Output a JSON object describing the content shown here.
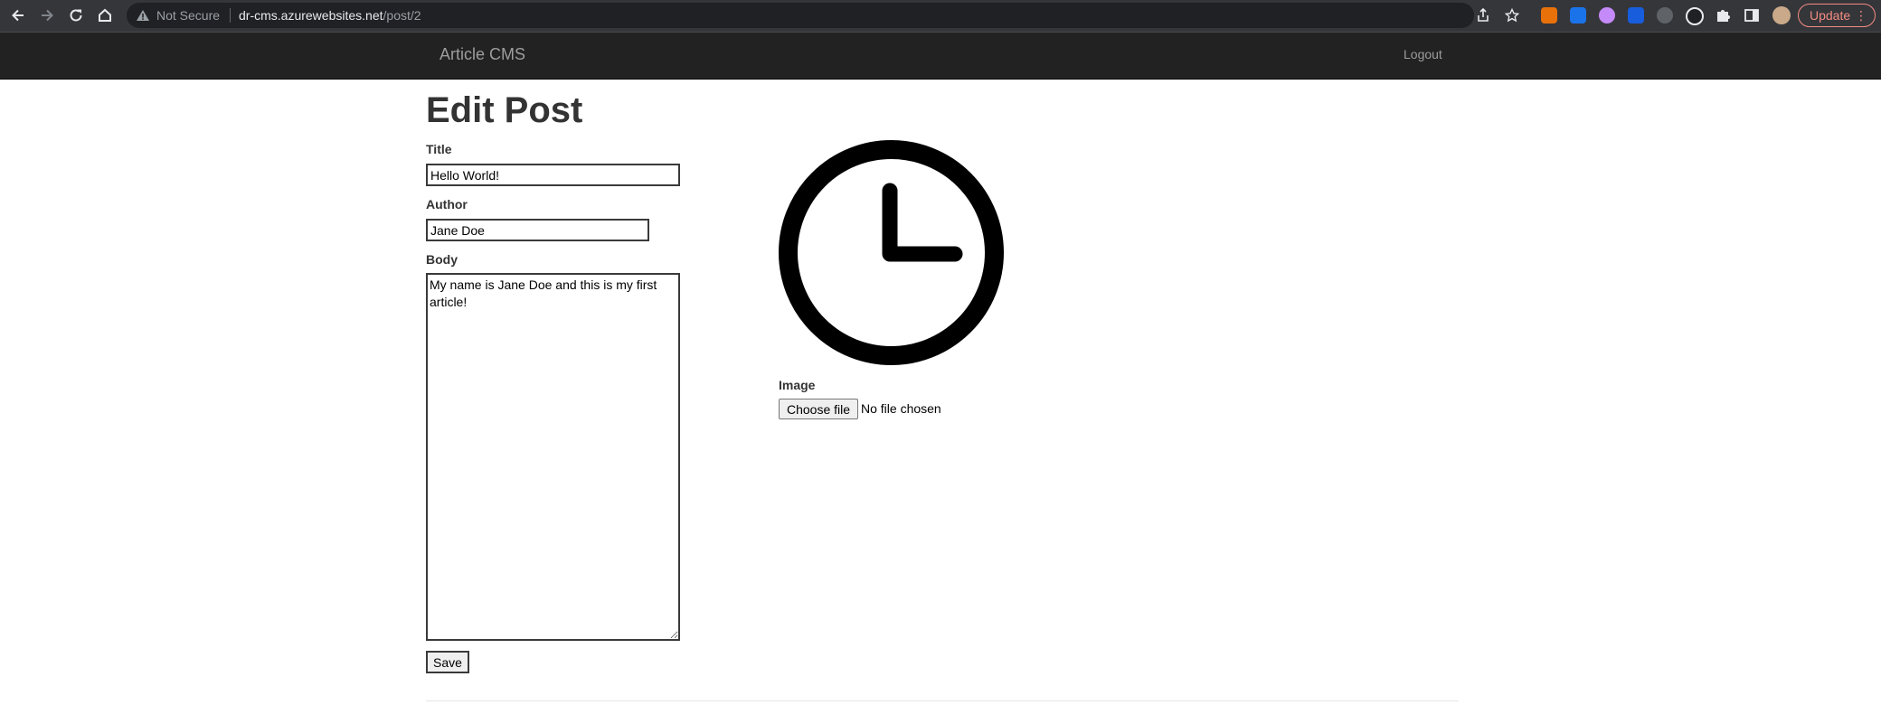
{
  "browser": {
    "security_label": "Not Secure",
    "url_host": "dr-cms.azurewebsites.net",
    "url_path": "/post/2",
    "update_label": "Update"
  },
  "site": {
    "brand": "Article CMS",
    "logout": "Logout"
  },
  "form": {
    "heading": "Edit Post",
    "title_label": "Title",
    "title_value": "Hello World!",
    "author_label": "Author",
    "author_value": "Jane Doe",
    "body_label": "Body",
    "body_value": "My name is Jane Doe and this is my first article!",
    "image_label": "Image",
    "choose_file_label": "Choose file",
    "file_status": "No file chosen",
    "save_label": "Save"
  },
  "icons": {
    "post_image": "clock-icon"
  }
}
